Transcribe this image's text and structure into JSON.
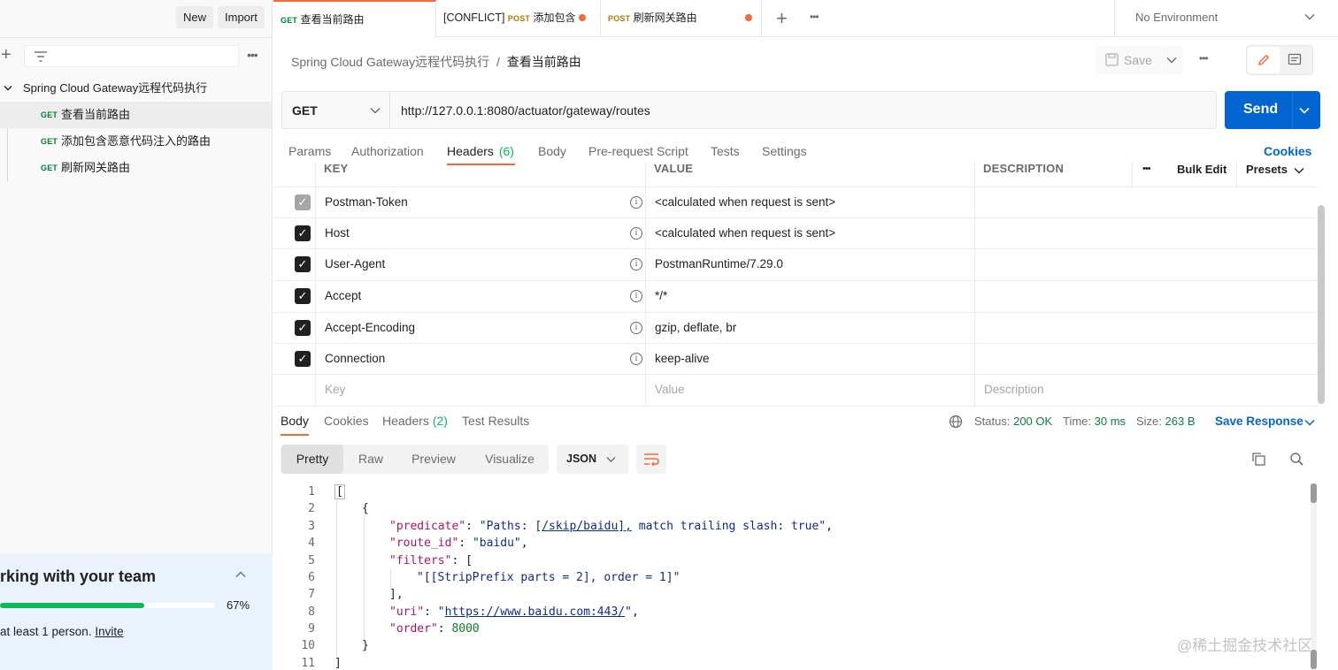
{
  "sidebar": {
    "new_label": "New",
    "import_label": "Import",
    "collection_name": "Spring Cloud Gateway远程代码执行",
    "items": [
      {
        "method": "GET",
        "label": "查看当前路由"
      },
      {
        "method": "GET",
        "label": "添加包含恶意代码注入的路由"
      },
      {
        "method": "GET",
        "label": "刷新网关路由"
      }
    ],
    "team": {
      "title": "rking with your team",
      "percent": "67%",
      "progress": 0.67,
      "text": "at least 1 person.",
      "invite": "Invite"
    }
  },
  "tabs": [
    {
      "method": "GET",
      "label": "查看当前路由",
      "active": true
    },
    {
      "prefix": "[CONFLICT]",
      "method": "POST",
      "label": "添加包含"
    },
    {
      "method": "POST",
      "label": "刷新网关路由"
    }
  ],
  "environment": "No Environment",
  "breadcrumb": {
    "collection": "Spring Cloud Gateway远程代码执行",
    "separator": "/",
    "request": "查看当前路由"
  },
  "toolbar": {
    "save_label": "Save"
  },
  "request": {
    "method": "GET",
    "url": "http://127.0.0.1:8080/actuator/gateway/routes",
    "send_label": "Send"
  },
  "request_tabs": {
    "params": "Params",
    "authorization": "Authorization",
    "headers": "Headers",
    "headers_count": "(6)",
    "body": "Body",
    "prerequest": "Pre-request Script",
    "tests": "Tests",
    "settings": "Settings",
    "cookies": "Cookies"
  },
  "headers_table": {
    "col_key": "KEY",
    "col_value": "VALUE",
    "col_description": "DESCRIPTION",
    "bulk_edit": "Bulk Edit",
    "presets": "Presets",
    "rows": [
      {
        "key": "Postman-Token",
        "value": "<calculated when request is sent>"
      },
      {
        "key": "Host",
        "value": "<calculated when request is sent>"
      },
      {
        "key": "User-Agent",
        "value": "PostmanRuntime/7.29.0"
      },
      {
        "key": "Accept",
        "value": "*/*"
      },
      {
        "key": "Accept-Encoding",
        "value": "gzip, deflate, br"
      },
      {
        "key": "Connection",
        "value": "keep-alive"
      }
    ],
    "placeholder_key": "Key",
    "placeholder_value": "Value",
    "placeholder_description": "Description"
  },
  "response": {
    "tabs": {
      "body": "Body",
      "cookies": "Cookies",
      "headers": "Headers",
      "headers_count": "(2)",
      "test_results": "Test Results"
    },
    "status_label": "Status:",
    "status_value": "200 OK",
    "time_label": "Time:",
    "time_value": "30 ms",
    "size_label": "Size:",
    "size_value": "263 B",
    "save_response": "Save Response",
    "views": {
      "pretty": "Pretty",
      "raw": "Raw",
      "preview": "Preview",
      "visualize": "Visualize"
    },
    "format": "JSON",
    "line_numbers": [
      "1",
      "2",
      "3",
      "4",
      "5",
      "6",
      "7",
      "8",
      "9",
      "10",
      "11"
    ],
    "code": {
      "l1": "[",
      "l2": "{",
      "l3_key": "\"predicate\"",
      "l3_val_a": "\"Paths: [",
      "l3_link": "/skip/baidu],",
      "l3_val_b": " match trailing slash: true\"",
      "l4_key": "\"route_id\"",
      "l4_val": "\"baidu\"",
      "l5_key": "\"filters\"",
      "l6_val": "\"[[StripPrefix parts = 2], order = 1]\"",
      "l7": "],",
      "l8_key": "\"uri\"",
      "l8_link": "https://www.baidu.com:443/",
      "l9_key": "\"order\"",
      "l9_val": "8000",
      "l10": "}",
      "l11": "]"
    }
  },
  "watermark": "@稀土掘金技术社区"
}
